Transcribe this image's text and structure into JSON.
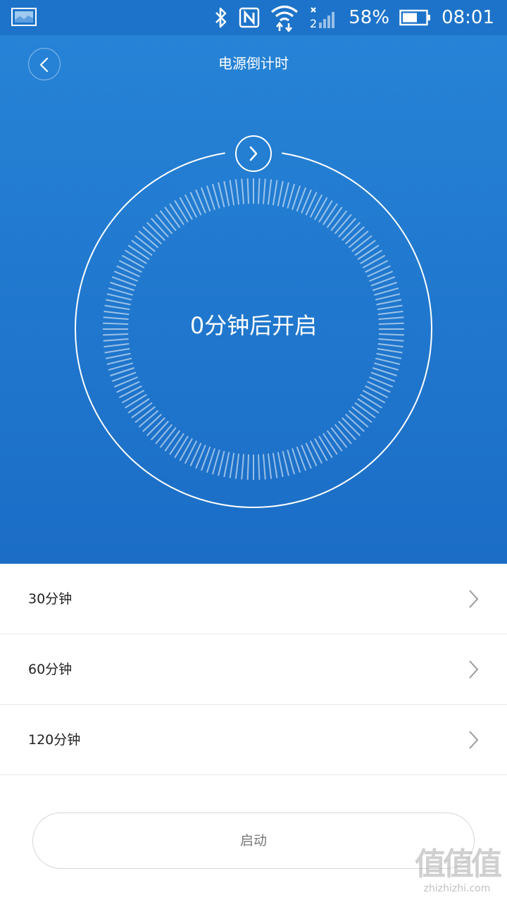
{
  "status_bar": {
    "battery": "58%",
    "time": "08:01",
    "icons": [
      "gallery-thumbnail-icon",
      "bluetooth-icon",
      "nfc-icon",
      "wifi-icon",
      "signal-icon",
      "battery-icon"
    ]
  },
  "header": {
    "title": "电源倒计时",
    "back_icon": "chevron-left-icon"
  },
  "dial": {
    "center_text": "0分钟后开启",
    "handle_icon": "chevron-right-icon",
    "progress_fraction": 0
  },
  "options": [
    {
      "label": "30分钟"
    },
    {
      "label": "60分钟"
    },
    {
      "label": "120分钟"
    }
  ],
  "start_button": {
    "label": "启动"
  },
  "watermark": {
    "text": "zhizhizhi.com"
  },
  "colors": {
    "accent": "#1d73c9",
    "hero_top": "#2683d6",
    "hero_bottom": "#1b6dc6",
    "text_primary": "#222222",
    "text_secondary": "#777777"
  }
}
